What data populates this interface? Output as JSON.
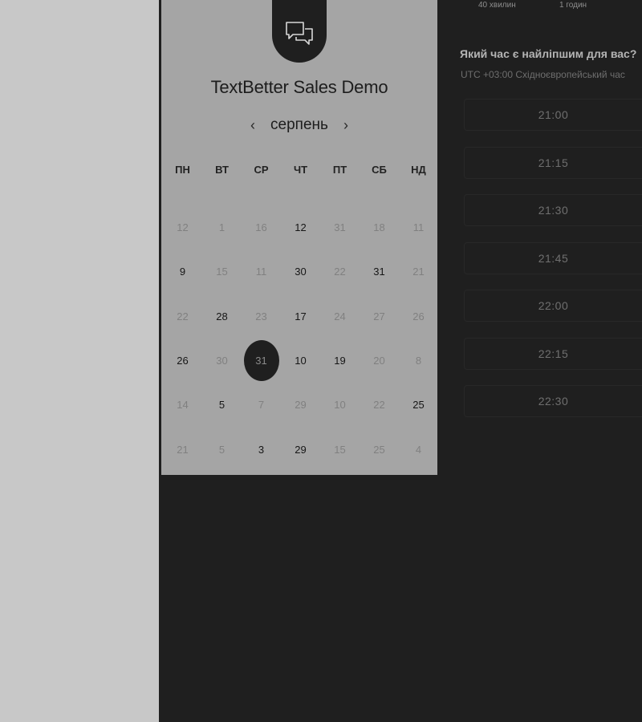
{
  "calendar": {
    "title": "TextBetter Sales Demo",
    "month": "серпень",
    "prev_symbol": "‹",
    "next_symbol": "›",
    "weekdays": [
      "ПН",
      "ВТ",
      "СР",
      "ЧТ",
      "ПТ",
      "СБ",
      "НД"
    ],
    "days": [
      {
        "label": "12",
        "state": "muted"
      },
      {
        "label": "1",
        "state": "muted"
      },
      {
        "label": "16",
        "state": "muted"
      },
      {
        "label": "12",
        "state": "available"
      },
      {
        "label": "31",
        "state": "muted"
      },
      {
        "label": "18",
        "state": "muted"
      },
      {
        "label": "11",
        "state": "muted"
      },
      {
        "label": "9",
        "state": "available"
      },
      {
        "label": "15",
        "state": "muted"
      },
      {
        "label": "11",
        "state": "muted"
      },
      {
        "label": "30",
        "state": "available"
      },
      {
        "label": "22",
        "state": "muted"
      },
      {
        "label": "31",
        "state": "available"
      },
      {
        "label": "21",
        "state": "muted"
      },
      {
        "label": "22",
        "state": "muted"
      },
      {
        "label": "28",
        "state": "available"
      },
      {
        "label": "23",
        "state": "muted"
      },
      {
        "label": "17",
        "state": "available"
      },
      {
        "label": "24",
        "state": "muted"
      },
      {
        "label": "27",
        "state": "muted"
      },
      {
        "label": "26",
        "state": "muted"
      },
      {
        "label": "26",
        "state": "available"
      },
      {
        "label": "30",
        "state": "muted"
      },
      {
        "label": "31",
        "state": "selected"
      },
      {
        "label": "10",
        "state": "available"
      },
      {
        "label": "19",
        "state": "available"
      },
      {
        "label": "20",
        "state": "muted"
      },
      {
        "label": "8",
        "state": "muted"
      },
      {
        "label": "14",
        "state": "muted"
      },
      {
        "label": "5",
        "state": "available"
      },
      {
        "label": "7",
        "state": "muted"
      },
      {
        "label": "29",
        "state": "muted"
      },
      {
        "label": "10",
        "state": "muted"
      },
      {
        "label": "22",
        "state": "muted"
      },
      {
        "label": "25",
        "state": "available"
      },
      {
        "label": "21",
        "state": "muted"
      },
      {
        "label": "5",
        "state": "muted"
      },
      {
        "label": "3",
        "state": "available"
      },
      {
        "label": "29",
        "state": "available"
      },
      {
        "label": "15",
        "state": "muted"
      },
      {
        "label": "25",
        "state": "muted"
      },
      {
        "label": "4",
        "state": "muted"
      }
    ]
  },
  "schedule": {
    "durations": [
      "40 хвилин",
      "1 годин"
    ],
    "question": "Який час є найліпшим для вас?",
    "timezone": "UTC +03:00 Східноєвропейський час",
    "slots": [
      "21:00",
      "21:15",
      "21:30",
      "21:45",
      "22:00",
      "22:15",
      "22:30"
    ]
  },
  "colors": {
    "page_background": "#1f1f1f",
    "left_panel": "#c8c8c8",
    "calendar_card": "#a5a5a5",
    "selected_day": "#1f1f1f"
  },
  "icons": {
    "logo": "chat-bubbles-icon"
  }
}
